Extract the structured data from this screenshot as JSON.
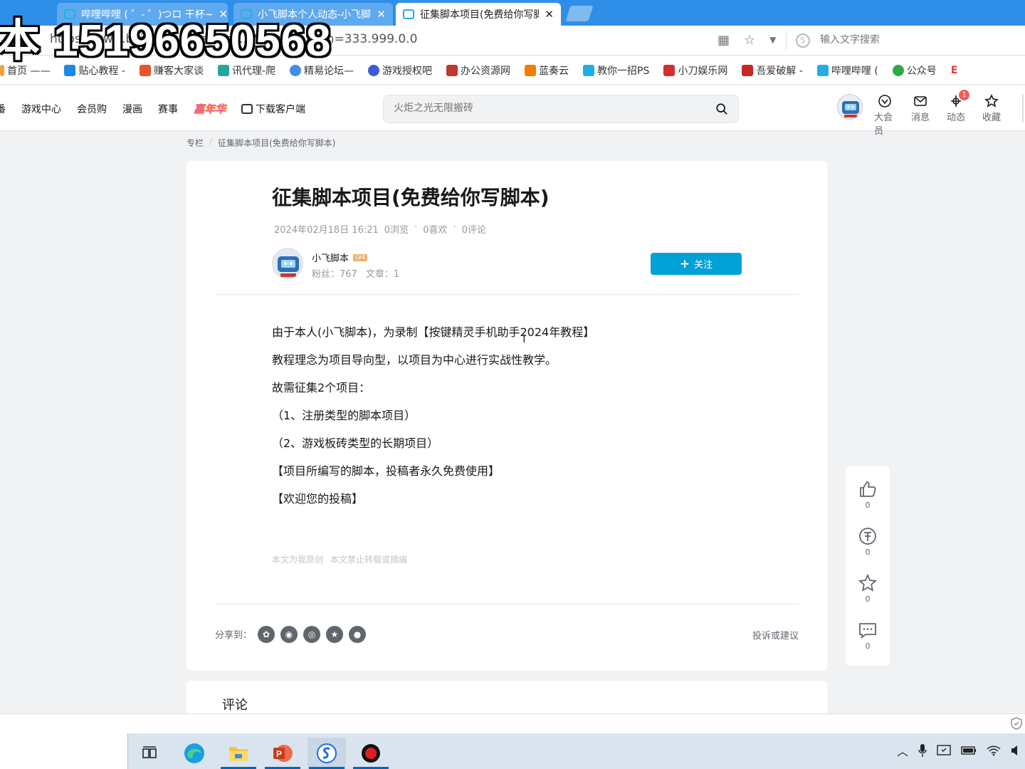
{
  "watermark": "本 15196650568",
  "browser": {
    "tabs": [
      {
        "label": "哔哩哔哩 ( ゜- ゜)つロ 干杯~"
      },
      {
        "label": "小飞脚本个人动态-小飞脚本"
      },
      {
        "label": "征集脚本项目(免费给你写脚本)"
      }
    ],
    "url": "https://www.bilibili.com/read/cv...?spm_id_from=333.999.0.0",
    "search_placeholder": "输入文字搜索",
    "bookmarks": [
      {
        "label": "首页 ——",
        "color": "#f2a03d"
      },
      {
        "label": "贴心教程 -",
        "color": "#1e88e5"
      },
      {
        "label": "赚客大家谈",
        "color": "#e8542c"
      },
      {
        "label": "讯代理-爬",
        "color": "#26a69a"
      },
      {
        "label": "精易论坛—",
        "color": "#3f8ee8"
      },
      {
        "label": "游戏授权吧",
        "color": "#3b5bdb"
      },
      {
        "label": "办公资源网",
        "color": "#c0392b"
      },
      {
        "label": "蓝奏云",
        "color": "#f57c00"
      },
      {
        "label": "教你一招PS",
        "color": "#23ade5"
      },
      {
        "label": "小刀娱乐网",
        "color": "#d32f2f"
      },
      {
        "label": "吾爱破解 -",
        "color": "#c62828"
      },
      {
        "label": "哔哩哔哩 (",
        "color": "#23ade5"
      },
      {
        "label": "公众号",
        "color": "#2eaa45"
      },
      {
        "label": "E",
        "color": "#e53935"
      }
    ]
  },
  "site": {
    "nav": [
      "番",
      "游戏中心",
      "会员购",
      "漫画",
      "赛事"
    ],
    "carnival": "嘉年华",
    "download": "下载客户端",
    "search_placeholder": "火炬之光无限搬砖",
    "header_actions": [
      {
        "label": "大会员",
        "icon": "vip-icon"
      },
      {
        "label": "消息",
        "icon": "message-icon"
      },
      {
        "label": "动态",
        "icon": "dynamic-icon",
        "badge": "1"
      },
      {
        "label": "收藏",
        "icon": "favorite-icon"
      }
    ]
  },
  "breadcrumb": {
    "root": "专栏",
    "sep": "/",
    "current": "征集脚本项目(免费给你写脚本)"
  },
  "article": {
    "title": "征集脚本项目(免费给你写脚本)",
    "date": "2024年02月18日 16:21",
    "views": "0浏览",
    "likes": "0喜欢",
    "comments": "0评论",
    "dot": "·",
    "author": {
      "name": "小飞脚本",
      "level": "LV4",
      "fans": "粉丝：767",
      "posts": "文章：1"
    },
    "follow_label": "关注",
    "paragraphs": [
      "由于本人(小飞脚本)，为录制【按键精灵手机助手2024年教程】",
      "教程理念为项目导向型，以项目为中心进行实战性教学。",
      "故需征集2个项目：",
      "（1、注册类型的脚本项目）",
      "（2、游戏板砖类型的长期项目）",
      "【项目所编写的脚本，投稿者永久免费使用】",
      "【欢迎您的投稿】"
    ],
    "original_note": "本文为我原创",
    "repost_note": "本文禁止转载或摘编",
    "share_label": "分享到：",
    "report_label": "投诉或建议"
  },
  "side_actions": {
    "like": "0",
    "coin": "0",
    "favorite": "0",
    "comment": "0"
  },
  "comments_title": "评论"
}
